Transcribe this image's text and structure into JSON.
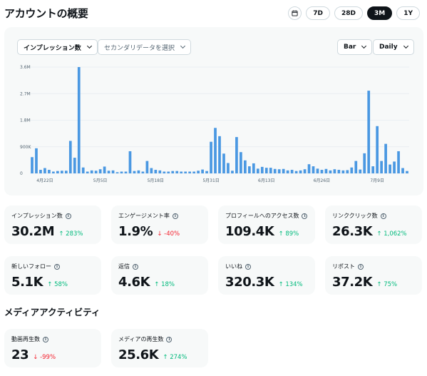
{
  "header": {
    "title": "アカウントの概要",
    "ranges": [
      {
        "label": "7D",
        "active": false
      },
      {
        "label": "28D",
        "active": false
      },
      {
        "label": "3M",
        "active": true
      },
      {
        "label": "1Y",
        "active": false
      }
    ]
  },
  "controls": {
    "primary_metric": "インプレッション数",
    "secondary_metric_placeholder": "セカンダリデータを選択",
    "chart_type": "Bar",
    "granularity": "Daily"
  },
  "chart_data": {
    "type": "bar",
    "y_ticks": [
      "0",
      "900K",
      "1.8M",
      "2.7M",
      "3.6M"
    ],
    "ylim": [
      0,
      3600000
    ],
    "x_tick_labels": [
      "4月22日",
      "5月5日",
      "5月18日",
      "5月31日",
      "6月13日",
      "6月26日",
      "7月9日"
    ],
    "x_tick_indices": [
      3,
      16,
      29,
      42,
      55,
      68,
      81
    ],
    "grid": true,
    "series": [
      {
        "color": "#4a98e2",
        "values": [
          550000,
          850000,
          120000,
          180000,
          120000,
          60000,
          80000,
          90000,
          90000,
          1100000,
          530000,
          3600000,
          200000,
          60000,
          100000,
          90000,
          140000,
          230000,
          90000,
          100000,
          40000,
          60000,
          60000,
          750000,
          80000,
          100000,
          60000,
          420000,
          180000,
          120000,
          100000,
          60000,
          60000,
          80000,
          80000,
          60000,
          60000,
          60000,
          60000,
          90000,
          130000,
          80000,
          1070000,
          1540000,
          1260000,
          670000,
          350000,
          90000,
          1230000,
          720000,
          440000,
          240000,
          340000,
          160000,
          220000,
          190000,
          190000,
          150000,
          140000,
          150000,
          100000,
          120000,
          80000,
          100000,
          140000,
          310000,
          240000,
          160000,
          120000,
          150000,
          100000,
          140000,
          120000,
          100000,
          110000,
          200000,
          420000,
          130000,
          680000,
          2800000,
          240000,
          1600000,
          420000,
          1000000,
          300000,
          400000,
          750000,
          180000,
          80000
        ]
      }
    ]
  },
  "stats": [
    {
      "label": "インプレッション数",
      "value": "30.2M",
      "change": "283%",
      "dir": "up"
    },
    {
      "label": "エンゲージメント率",
      "value": "1.9%",
      "change": "-40%",
      "dir": "down"
    },
    {
      "label": "プロフィールへのアクセス数",
      "value": "109.4K",
      "change": "89%",
      "dir": "up"
    },
    {
      "label": "リンククリック数",
      "value": "26.3K",
      "change": "1,062%",
      "dir": "up"
    },
    {
      "label": "新しいフォロー",
      "value": "5.1K",
      "change": "58%",
      "dir": "up"
    },
    {
      "label": "返信",
      "value": "4.6K",
      "change": "18%",
      "dir": "up"
    },
    {
      "label": "いいね",
      "value": "320.3K",
      "change": "134%",
      "dir": "up"
    },
    {
      "label": "リポスト",
      "value": "37.2K",
      "change": "75%",
      "dir": "up"
    }
  ],
  "media_section": {
    "title": "メディアアクティビティ",
    "stats": [
      {
        "label": "動画再生数",
        "value": "23",
        "change": "-99%",
        "dir": "down"
      },
      {
        "label": "メディアの再生数",
        "value": "25.6K",
        "change": "274%",
        "dir": "up"
      }
    ]
  },
  "icons": {
    "info": "info-icon",
    "calendar": "calendar-icon",
    "up_arrow": "↑",
    "down_arrow": "↓"
  }
}
